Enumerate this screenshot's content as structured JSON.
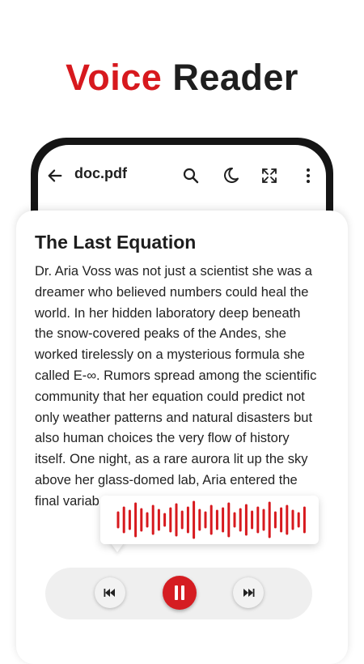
{
  "headline": {
    "word1": "Voice",
    "word2": "Reader"
  },
  "topbar": {
    "filename": "doc.pdf",
    "icons": [
      "back-arrow-icon",
      "search-icon",
      "night-mode-icon",
      "fullscreen-icon",
      "more-vert-icon"
    ]
  },
  "document": {
    "title": "The Last Equation",
    "lines": [
      "Dr. Aria Voss was not just a scientist she was a",
      "dreamer who believed numbers could heal the",
      "world. In her hidden laboratory deep beneath",
      "the snow-covered peaks of the Andes, she",
      "worked tirelessly on a mysterious formula she",
      "called E-∞. Rumors spread among the scientific",
      "community that her equation could predict not",
      "only weather patterns and natural disasters but",
      "also human choices the very flow of history",
      "itself. One night, as a rare aurora lit up the sky",
      "above her glass-domed lab, Aria entered the",
      "final variab"
    ]
  },
  "player": {
    "state": "playing",
    "buttons": [
      "previous-icon",
      "pause-icon",
      "next-icon"
    ]
  },
  "colors": {
    "accent": "#d7191e",
    "text": "#1e1e1e",
    "control_bg": "#efefef"
  }
}
